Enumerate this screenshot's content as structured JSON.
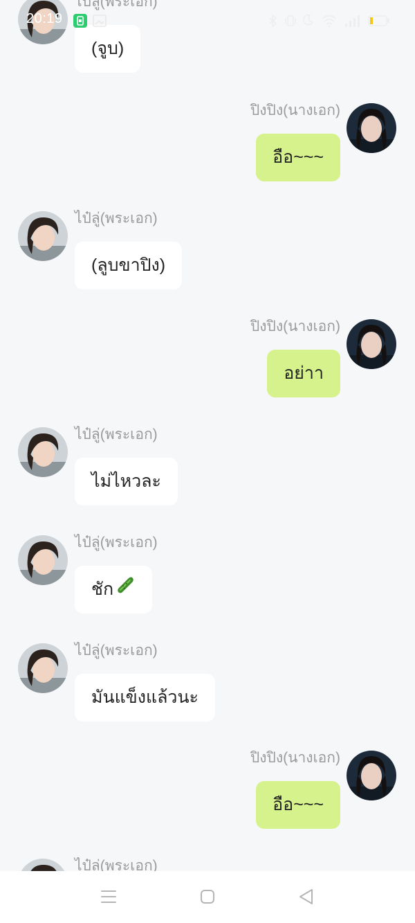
{
  "status_bar": {
    "time": "20:19",
    "icons": [
      "app-notification-icon",
      "image-icon",
      "bluetooth-icon",
      "vibrate-icon",
      "moon-icon",
      "wifi-icon",
      "signal-icon",
      "battery-icon"
    ]
  },
  "chat": {
    "messages": [
      {
        "side": "left",
        "sender": "ไป๋ลู่(พระเอก)",
        "text": "(จูบ)"
      },
      {
        "side": "right",
        "sender": "ปิงปิง(นางเอก)",
        "text": "อือ~~~"
      },
      {
        "side": "left",
        "sender": "ไป๋ลู่(พระเอก)",
        "text": "(ลูบขาปิง)"
      },
      {
        "side": "right",
        "sender": "ปิงปิง(นางเอก)",
        "text": "อย่าา"
      },
      {
        "side": "left",
        "sender": "ไป๋ลู่(พระเอก)",
        "text": "ไม่ไหวละ"
      },
      {
        "side": "left",
        "sender": "ไป๋ลู่(พระเอก)",
        "text": "ชัก",
        "emoji": "cucumber-icon"
      },
      {
        "side": "left",
        "sender": "ไป๋ลู่(พระเอก)",
        "text": "มันแข็งแล้วนะ"
      },
      {
        "side": "right",
        "sender": "ปิงปิง(นางเอก)",
        "text": "อือ~~~"
      },
      {
        "side": "left",
        "sender": "ไป๋ลู่(พระเอก)",
        "text": ""
      }
    ]
  },
  "nav_bar": {
    "buttons": [
      "menu-icon",
      "home-icon",
      "back-icon"
    ]
  },
  "colors": {
    "background": "#f6f7f9",
    "left_bubble": "#ffffff",
    "right_bubble": "#d6f28c",
    "sender_text": "#9a9a9a"
  }
}
